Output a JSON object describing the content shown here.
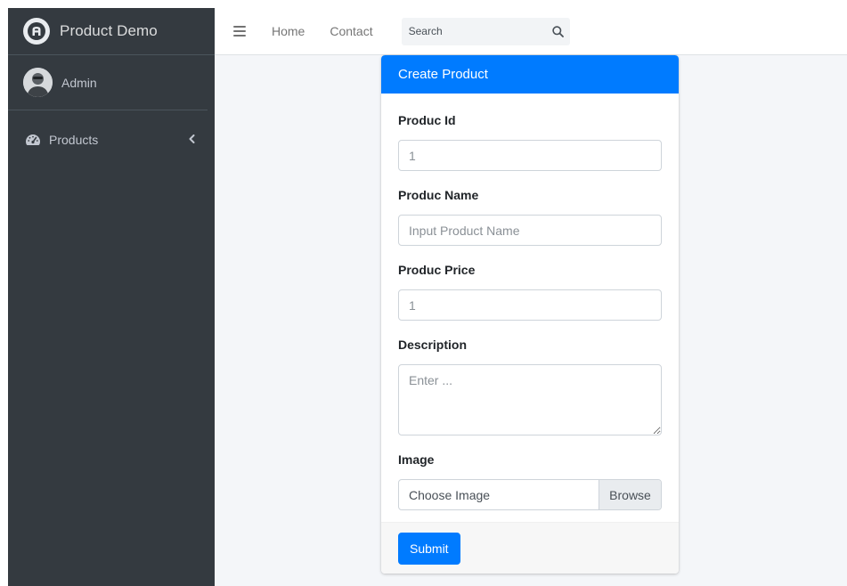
{
  "brand": {
    "name": "Product Demo",
    "logo_icon": "adminlte-logo-icon"
  },
  "user": {
    "name": "Admin",
    "avatar_icon": "user-avatar"
  },
  "sidebar": {
    "items": [
      {
        "label": "Products",
        "icon": "dashboard-gauge-icon",
        "chevron": "‹"
      }
    ]
  },
  "navbar": {
    "links": [
      "Home",
      "Contact"
    ],
    "search": {
      "placeholder": "Search",
      "icon": "search-icon"
    }
  },
  "form": {
    "title": "Create Product",
    "fields": {
      "product_id": {
        "label": "Produc Id",
        "placeholder": "1"
      },
      "product_name": {
        "label": "Produc Name",
        "placeholder": "Input Product Name"
      },
      "product_price": {
        "label": "Produc Price",
        "placeholder": "1"
      },
      "description": {
        "label": "Description",
        "placeholder": "Enter ..."
      },
      "image": {
        "label": "Image",
        "file_label": "Choose Image",
        "browse_label": "Browse"
      }
    },
    "submit_label": "Submit"
  },
  "colors": {
    "sidebar_bg": "#343a40",
    "primary": "#007bff",
    "content_bg": "#f4f6f9"
  }
}
